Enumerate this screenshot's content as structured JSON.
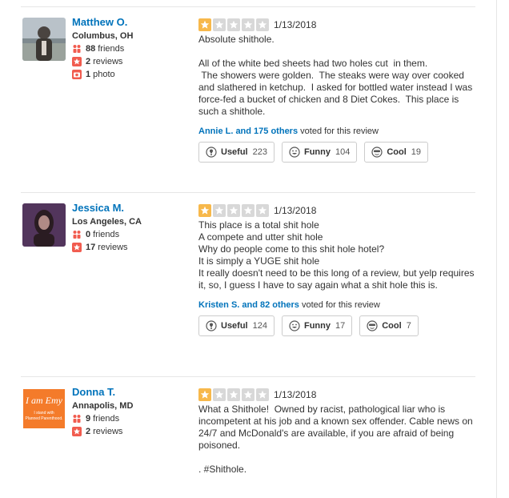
{
  "reviews": [
    {
      "user": {
        "name": "Matthew O.",
        "location": "Columbus, OH",
        "friends": "88",
        "friends_label": "friends",
        "reviews": "2",
        "reviews_label": "reviews",
        "photos": "1",
        "photos_label": "photo"
      },
      "rating": 1,
      "date": "1/13/2018",
      "text": "Absolute shithole.\n\nAll of the white bed sheets had two holes cut  in them.\n The showers were golden.  The steaks were way over cooked and slathered in ketchup.  I asked for bottled water instead I was force-fed a bucket of chicken and 8 Diet Cokes.  This place is such a shithole.",
      "voters": "Annie L. and 175 others",
      "voted_suffix": "voted for this review",
      "votes": {
        "useful_label": "Useful",
        "useful": "223",
        "funny_label": "Funny",
        "funny": "104",
        "cool_label": "Cool",
        "cool": "19"
      }
    },
    {
      "user": {
        "name": "Jessica M.",
        "location": "Los Angeles, CA",
        "friends": "0",
        "friends_label": "friends",
        "reviews": "17",
        "reviews_label": "reviews"
      },
      "rating": 1,
      "date": "1/13/2018",
      "text": "This place is a total shit hole\nA compete and utter shit hole\nWhy do people come to this shit hole hotel?\nIt is simply a YUGE shit hole\nIt really doesn't need to be this long of a review, but yelp requires it, so, I guess I have to say again what a shit hole this is.",
      "voters": "Kristen S. and 82 others",
      "voted_suffix": "voted for this review",
      "votes": {
        "useful_label": "Useful",
        "useful": "124",
        "funny_label": "Funny",
        "funny": "17",
        "cool_label": "Cool",
        "cool": "7"
      }
    },
    {
      "user": {
        "name": "Donna T.",
        "location": "Annapolis, MD",
        "friends": "9",
        "friends_label": "friends",
        "reviews": "2",
        "reviews_label": "reviews",
        "avatar_text1": "I am Emy",
        "avatar_text2": "I stand with",
        "avatar_text3": "Planned Parenthood."
      },
      "rating": 1,
      "date": "1/13/2018",
      "text": "What a Shithole!  Owned by racist, pathological liar who is incompetent at his job and a known sex offender. Cable news on 24/7 and McDonald's are available, if you are afraid of being poisoned.\n\n. #Shithole."
    }
  ],
  "colors": {
    "link": "#0073bb",
    "star_on": "#f7b84b",
    "star_off": "#d8d8d8",
    "badge_red": "#f15c4f"
  },
  "icons": [
    "friends-icon",
    "review-icon",
    "photo-icon",
    "star-icon",
    "useful-icon",
    "funny-icon",
    "cool-icon"
  ]
}
